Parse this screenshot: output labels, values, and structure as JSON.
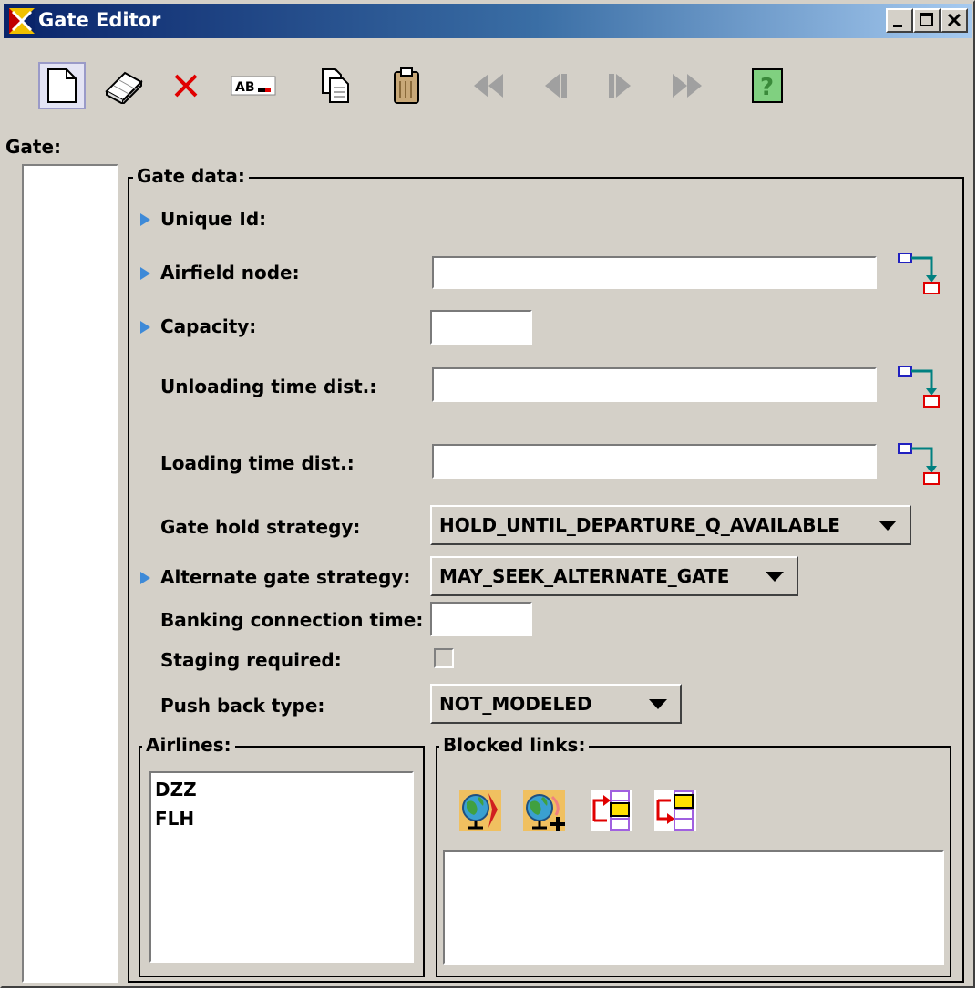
{
  "window": {
    "title": "Gate Editor",
    "controls": [
      "_",
      "□",
      "×"
    ]
  },
  "toolbar": {
    "new_icon": "new-document-icon",
    "eraser_icon": "eraser-icon",
    "delete_icon": "delete-x-icon",
    "rename_icon": "rename-text-icon",
    "copy_icon": "copy-icon",
    "paste_icon": "paste-clipboard-icon",
    "first_icon": "rewind-first-icon",
    "prev_icon": "previous-icon",
    "next_icon": "next-icon",
    "last_icon": "fast-forward-last-icon",
    "help_icon": "help-question-icon"
  },
  "gate_label": "Gate:",
  "gate_data": {
    "frame_title": "Gate data:",
    "unique_id_label": "Unique Id:",
    "airfield_node_label": "Airfield node:",
    "airfield_node_value": "",
    "capacity_label": "Capacity:",
    "capacity_value": "",
    "unloading_label": "Unloading time dist.:",
    "unloading_value": "",
    "loading_label": "Loading time dist.:",
    "loading_value": "",
    "gate_hold_label": "Gate hold strategy:",
    "gate_hold_value": "HOLD_UNTIL_DEPARTURE_Q_AVAILABLE",
    "alternate_gate_label": "Alternate gate strategy:",
    "alternate_gate_value": "MAY_SEEK_ALTERNATE_GATE",
    "banking_label": "Banking connection time:",
    "banking_value": "",
    "staging_label": "Staging required:",
    "staging_checked": false,
    "push_back_label": "Push back type:",
    "push_back_value": "NOT_MODELED"
  },
  "airlines": {
    "frame_title": "Airlines:",
    "items": [
      "DZZ",
      "FLH"
    ]
  },
  "blocked_links": {
    "frame_title": "Blocked links:",
    "icons": [
      "globe-link-icon",
      "globe-add-icon",
      "link-add-icon",
      "link-remove-icon"
    ]
  },
  "colors": {
    "background": "#d4d0c8",
    "title_start": "#0a246a",
    "title_end": "#a6caf0",
    "required_marker": "#3e8ad8"
  }
}
